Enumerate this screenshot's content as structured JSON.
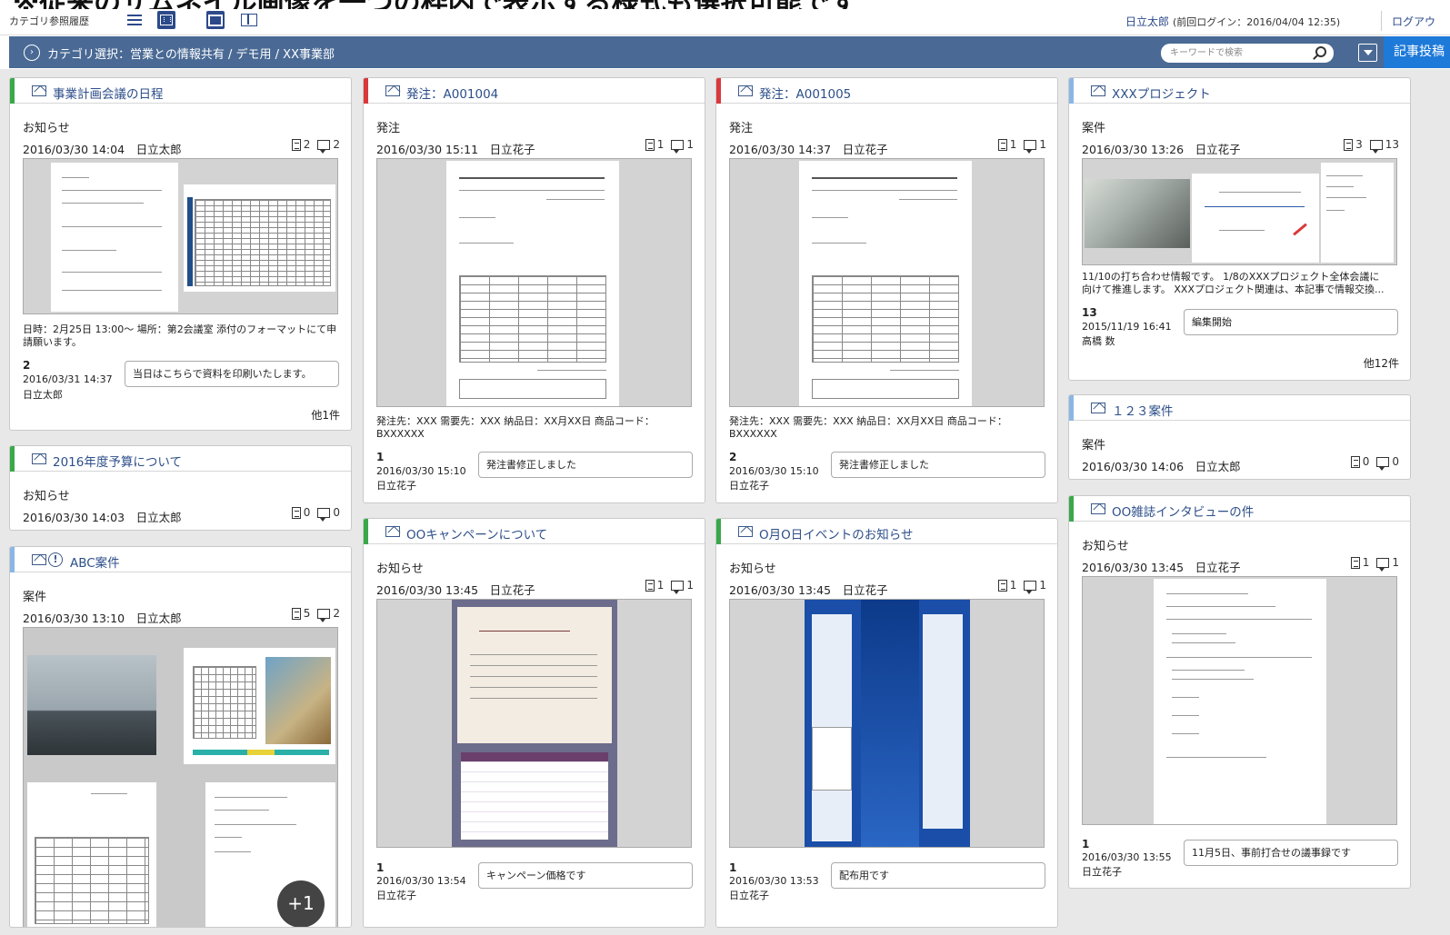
{
  "banner_text": "※従来のサムネイル画像を一つの枠内で表示する様式も選択可能です",
  "topbar": {
    "history_label": "カテゴリ参照履歴",
    "user_name": "日立太郎",
    "last_login": "(前回ログイン：2016/04/04 12:35)",
    "logout": "ログアウ",
    "view_icons": [
      "list-view-icon",
      "grid-view-icon",
      "large-view-icon",
      "split-view-icon"
    ],
    "active_view": "large-view-icon"
  },
  "nav": {
    "breadcrumb": "カテゴリ選択：営業との情報共有 / デモ用 / XX事業部",
    "search_placeholder": "キーワードで検索",
    "post_button": "記事投稿"
  },
  "colors": {
    "nav_bg": "#4a6a95",
    "accent_blue": "#1e7ad9",
    "green": "#3aa84a",
    "red": "#d9383a",
    "light_blue": "#8ab6e6"
  },
  "cards": [
    {
      "title": "事業計画会議の日程",
      "stripe": "green",
      "category": "お知らせ",
      "date": "2016/03/30 14:04",
      "author": "日立太郎",
      "docs": "2",
      "comments": "2",
      "description": "日時：2月25日 13:00～ 場所：第2会議室 添付のフォーマットにて申請願います。",
      "comment_count": "2",
      "comment_time": "2016/03/31 14:37",
      "comment_user": "日立太郎",
      "comment_text": "当日はこちらで資料を印刷いたします。",
      "more": "他1件"
    },
    {
      "title": "2016年度予算について",
      "stripe": "green",
      "category": "お知らせ",
      "date": "2016/03/30 14:03",
      "author": "日立太郎",
      "docs": "0",
      "comments": "0"
    },
    {
      "title": "ABC案件",
      "stripe": "light_blue",
      "category": "案件",
      "date": "2016/03/30 13:10",
      "author": "日立太郎",
      "docs": "5",
      "comments": "2",
      "extra_images": "+1"
    },
    {
      "title": "発注：A001004",
      "stripe": "red",
      "category": "発注",
      "date": "2016/03/30 15:11",
      "author": "日立花子",
      "docs": "1",
      "comments": "1",
      "description": "発注先：XXX 需要先：XXX 納品日：XX月XX日 商品コード：BXXXXXX",
      "comment_count": "1",
      "comment_time": "2016/03/30 15:10",
      "comment_user": "日立花子",
      "comment_text": "発注書修正しました"
    },
    {
      "title": "OOキャンペーンについて",
      "stripe": "green",
      "category": "お知らせ",
      "date": "2016/03/30 13:45",
      "author": "日立花子",
      "docs": "1",
      "comments": "1",
      "comment_count": "1",
      "comment_time": "2016/03/30 13:54",
      "comment_user": "日立花子",
      "comment_text": "キャンペーン価格です"
    },
    {
      "title": "発注：A001005",
      "stripe": "red",
      "category": "発注",
      "date": "2016/03/30 14:37",
      "author": "日立花子",
      "docs": "1",
      "comments": "1",
      "description": "発注先：XXX 需要先：XXX 納品日：XX月XX日 商品コード：BXXXXXX",
      "comment_count": "2",
      "comment_time": "2016/03/30 15:10",
      "comment_user": "日立花子",
      "comment_text": "発注書修正しました"
    },
    {
      "title": "O月O日イベントのお知らせ",
      "stripe": "green",
      "category": "お知らせ",
      "date": "2016/03/30 13:45",
      "author": "日立花子",
      "docs": "1",
      "comments": "1",
      "comment_count": "1",
      "comment_time": "2016/03/30 13:53",
      "comment_user": "日立花子",
      "comment_text": "配布用です"
    },
    {
      "title": "XXXプロジェクト",
      "stripe": "light_blue",
      "category": "案件",
      "date": "2016/03/30 13:26",
      "author": "日立花子",
      "docs": "3",
      "comments": "13",
      "description_1": "11/10の打ち合わせ情報です。 1/8のXXXプロジェクト全体会議に",
      "description_2": "向けて推進します。 XXXプロジェクト関連は、本記事で情報交換...",
      "comment_count": "13",
      "comment_time": "2015/11/19 16:41",
      "comment_user": "高橋 数",
      "comment_text": "編集開始",
      "more": "他12件"
    },
    {
      "title": "１２３案件",
      "stripe": "light_blue",
      "category": "案件",
      "date": "2016/03/30 14:06",
      "author": "日立太郎",
      "docs": "0",
      "comments": "0"
    },
    {
      "title": "OO雑誌インタビューの件",
      "stripe": "green",
      "category": "お知らせ",
      "date": "2016/03/30 13:45",
      "author": "日立花子",
      "docs": "1",
      "comments": "1",
      "comment_count": "1",
      "comment_time": "2016/03/30 13:55",
      "comment_user": "日立花子",
      "comment_text": "11月5日、事前打合せの議事録です"
    }
  ]
}
